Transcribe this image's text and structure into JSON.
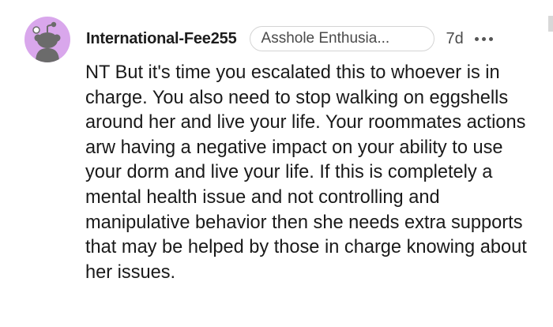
{
  "comment": {
    "author": "International-Fee255",
    "flair": "Asshole Enthusia...",
    "time": "7d",
    "avatar_icon": "snoo-avatar-icon",
    "avatar_color": "#d9a7ec",
    "more_icon": "more-options-icon",
    "body": "NT But it's time you escalated this to whoever is in charge. You also need to stop walking on eggshells around her and live your life. Your roommates actions arw having a negative impact on your ability to use your dorm and live your life. If this is completely a mental health issue and not controlling and manipulative behavior then she needs extra supports that may be helped by those in charge knowing about her issues."
  }
}
